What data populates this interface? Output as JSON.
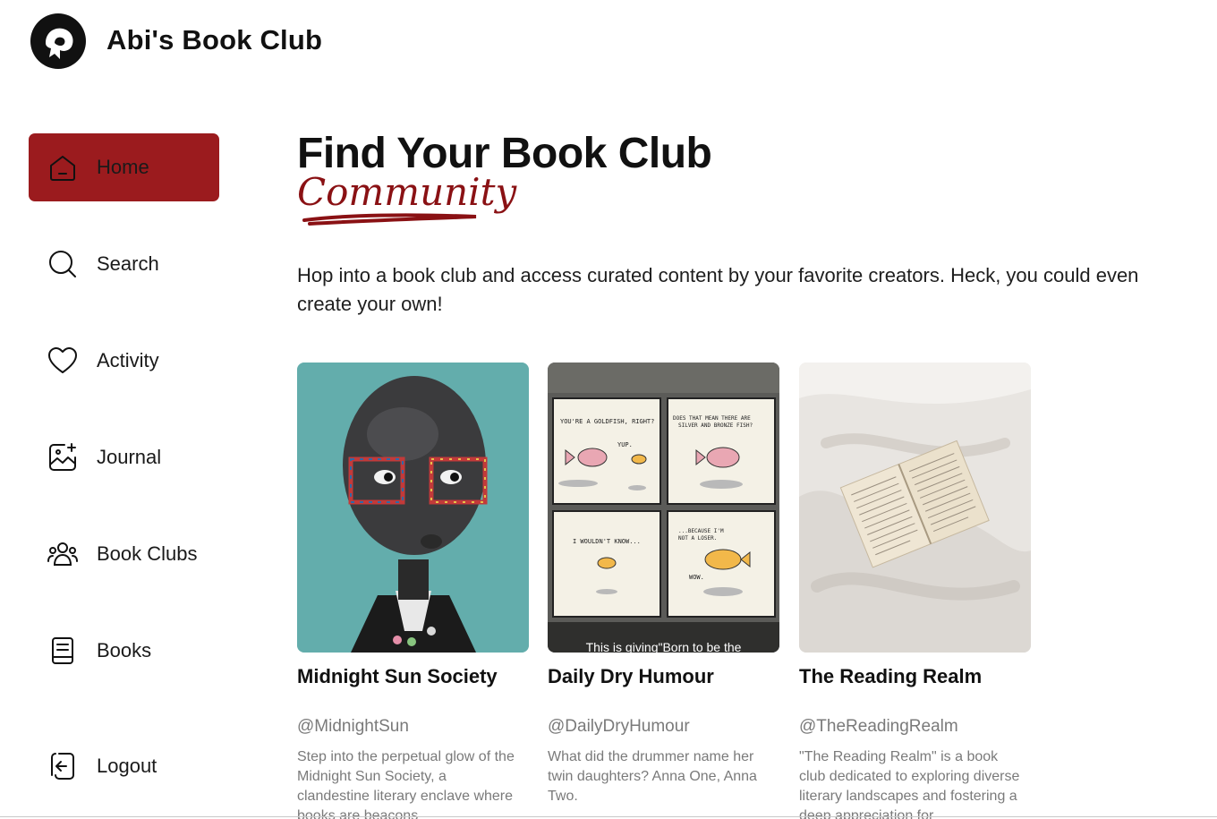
{
  "app": {
    "title": "Abi's Book Club",
    "logo_icon": "book-club-logo"
  },
  "sidebar": {
    "items": [
      {
        "label": "Home",
        "icon": "home-icon",
        "active": true
      },
      {
        "label": "Search",
        "icon": "search-icon",
        "active": false
      },
      {
        "label": "Activity",
        "icon": "heart-icon",
        "active": false
      },
      {
        "label": "Journal",
        "icon": "journal-icon",
        "active": false
      },
      {
        "label": "Book Clubs",
        "icon": "people-icon",
        "active": false
      },
      {
        "label": "Books",
        "icon": "book-icon",
        "active": false
      },
      {
        "label": "Logout",
        "icon": "logout-icon",
        "active": false
      }
    ]
  },
  "main": {
    "title": "Find Your Book Club",
    "script_word": "Community",
    "intro": "Hop into a book club and access curated content by your favorite creators. Heck, you could even create your own!"
  },
  "clubs": [
    {
      "title": "Midnight Sun Society",
      "handle": "@MidnightSun",
      "description": "Step into the perpetual glow of the Midnight Sun Society, a clandestine literary enclave where books are beacons",
      "caption": ""
    },
    {
      "title": "Daily Dry Humour",
      "handle": "@DailyDryHumour",
      "description": "What did the drummer name her twin daughters? Anna One, Anna Two.",
      "caption": "This is giving\"Born to be the"
    },
    {
      "title": "The Reading Realm",
      "handle": "@TheReadingRealm",
      "description": "\"The Reading Realm\" is a book club dedicated to exploring diverse literary landscapes and fostering a deep appreciation for",
      "caption": ""
    }
  ],
  "comic": {
    "panel1a": "YOU'RE A GOLDFISH, RIGHT?",
    "panel1b": "YUP.",
    "panel2": "DOES THAT MEAN THERE ARE SILVER AND BRONZE FISH?",
    "panel3": "I WOULDN'T KNOW...",
    "panel4a": "...BECAUSE I'M NOT A LOSER.",
    "panel4b": "WOW."
  },
  "colors": {
    "accent": "#9b1b1e",
    "script": "#8a1114",
    "muted": "#7a7a7a"
  }
}
